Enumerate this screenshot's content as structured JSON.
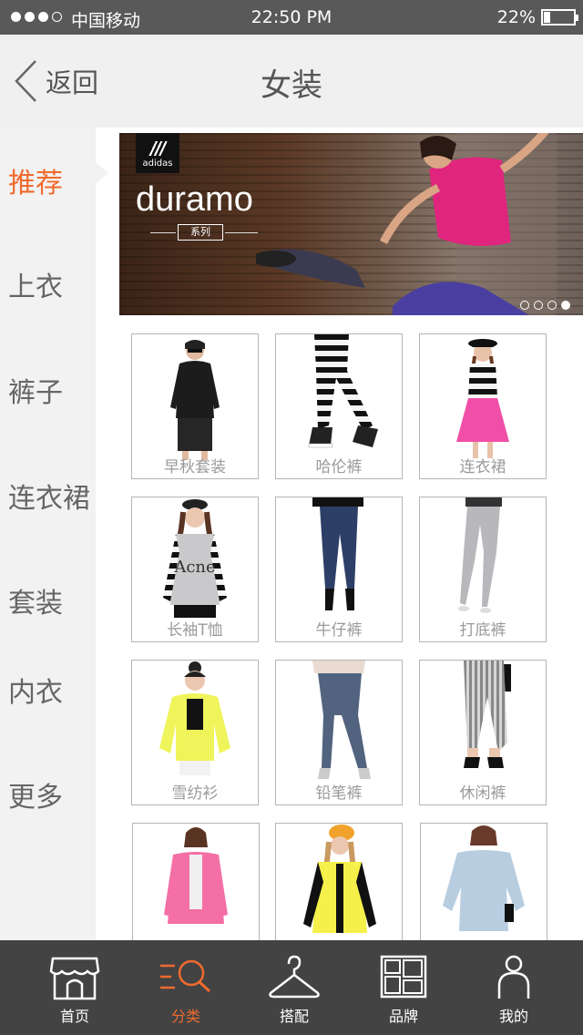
{
  "status_bar": {
    "carrier": "中国移动",
    "time": "22:50 PM",
    "battery_percent": "22%",
    "battery_level": 0.22
  },
  "nav": {
    "back_label": "返回",
    "title": "女装"
  },
  "sidebar": {
    "items": [
      {
        "label": "推荐",
        "active": true
      },
      {
        "label": "上衣",
        "active": false
      },
      {
        "label": "裤子",
        "active": false
      },
      {
        "label": "连衣裙",
        "active": false
      },
      {
        "label": "套装",
        "active": false
      },
      {
        "label": "内衣",
        "active": false
      },
      {
        "label": "更多",
        "active": false
      }
    ]
  },
  "banner": {
    "brand": "adidas",
    "title": "duramo",
    "subtitle": "系列",
    "slide_count": 4,
    "active_slide": 4
  },
  "products": [
    {
      "label": "早秋套装",
      "icon": "black-velour-suit-image"
    },
    {
      "label": "哈伦裤",
      "icon": "striped-leggings-image"
    },
    {
      "label": "连衣裙",
      "icon": "pink-skirt-dress-image"
    },
    {
      "label": "长袖T恤",
      "icon": "acne-sweater-image"
    },
    {
      "label": "牛仔裤",
      "icon": "skinny-jeans-image"
    },
    {
      "label": "打底裤",
      "icon": "grey-leggings-image"
    },
    {
      "label": "雪纺衫",
      "icon": "yellow-chiffon-shirt-image"
    },
    {
      "label": "铅笔裤",
      "icon": "pencil-jeans-image"
    },
    {
      "label": "休闲裤",
      "icon": "striped-casual-pants-image"
    },
    {
      "label": "",
      "icon": "pink-blazer-image"
    },
    {
      "label": "",
      "icon": "yellow-cardigan-image"
    },
    {
      "label": "",
      "icon": "denim-shirt-image"
    }
  ],
  "tab_bar": {
    "items": [
      {
        "label": "首页",
        "icon": "store-icon",
        "active": false
      },
      {
        "label": "分类",
        "icon": "category-search-icon",
        "active": true
      },
      {
        "label": "搭配",
        "icon": "hanger-icon",
        "active": false
      },
      {
        "label": "品牌",
        "icon": "brand-grid-icon",
        "active": false
      },
      {
        "label": "我的",
        "icon": "user-icon",
        "active": false
      }
    ]
  },
  "colors": {
    "accent": "#f06a2e",
    "status_bar": "#595959",
    "tab_bar": "#434343",
    "nav_bg": "#f0f0f0",
    "sidebar_bg": "#f2f2f2"
  }
}
